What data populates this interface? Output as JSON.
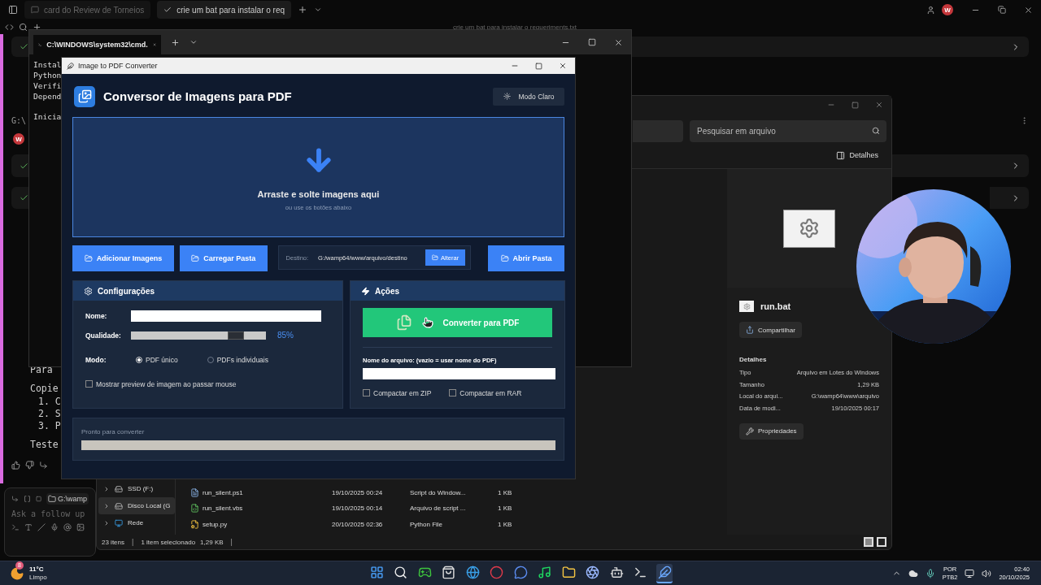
{
  "editor": {
    "tabs": [
      {
        "label": "card do Review de Torneios",
        "selected": false
      },
      {
        "label": "crie um bat para instalar o req",
        "selected": true
      }
    ],
    "avatar": "W",
    "thread_title": "crie um bat para instalar o requeriments.txt",
    "margin_text": "G:\\",
    "chat_avatar": "W",
    "chat_blocks": [
      {
        "kind": "text",
        "lines": [
          "Para"
        ]
      },
      {
        "kind": "text",
        "lines": [
          "Copie"
        ]
      },
      {
        "kind": "list",
        "lines": [
          "1. C",
          "2. S",
          "3. P"
        ]
      },
      {
        "kind": "text",
        "lines": [
          "Teste"
        ]
      }
    ],
    "composer": {
      "path": "G:\\wamp",
      "placeholder": "Ask a follow up"
    }
  },
  "cmd": {
    "tab": "C:\\WINDOWS\\system32\\cmd.",
    "blocks": [
      [
        "Instal",
        "Python",
        "Verifi",
        "Depend"
      ],
      [
        "Inicia"
      ]
    ]
  },
  "explorer": {
    "search": {
      "placeholder": "Pesquisar em arquivo"
    },
    "details_button": "Detalhes",
    "file": "run.bat",
    "share": "Compartilhar",
    "details_heading": "Detalhes",
    "properties": [
      {
        "label": "Tipo",
        "value": "Arquivo em Lotes do Windows"
      },
      {
        "label": "Tamanho",
        "value": "1,29 KB"
      },
      {
        "label": "Local do arqui...",
        "value": "G:\\wamp64\\www\\arquivo"
      },
      {
        "label": "Data de modi...",
        "value": "19/10/2025 00:17"
      }
    ],
    "properties_button": "Propriedades",
    "tree": [
      {
        "label": "SSD (F:)",
        "kind": "drive",
        "selected": false
      },
      {
        "label": "Disco Local (G",
        "kind": "drive",
        "selected": true
      },
      {
        "label": "Rede",
        "kind": "network",
        "selected": false
      }
    ],
    "files": [
      {
        "name": "run_silent.ps1",
        "kind": "script",
        "date": "19/10/2025 00:24",
        "type": "Script do Window...",
        "size": "1 KB"
      },
      {
        "name": "run_silent.vbs",
        "kind": "vbs",
        "date": "19/10/2025 00:14",
        "type": "Arquivo de script ...",
        "size": "1 KB"
      },
      {
        "name": "setup.py",
        "kind": "python",
        "date": "20/10/2025 02:36",
        "type": "Python File",
        "size": "1 KB"
      }
    ],
    "status": [
      {
        "kind": "text",
        "text": "23 itens"
      },
      {
        "kind": "separator",
        "text": "|"
      },
      {
        "kind": "text",
        "text": "1 item selecionado"
      },
      {
        "kind": "text",
        "text": "1,29 KB"
      },
      {
        "kind": "separator",
        "text": "|"
      }
    ]
  },
  "app": {
    "title": "Image to PDF Converter",
    "heading": "Conversor de Imagens para PDF",
    "theme_button": "Modo Claro",
    "dropzone": {
      "title": "Arraste e solte imagens aqui",
      "hint": "ou use os botões abaixo"
    },
    "buttons": [
      "Adicionar Imagens",
      "Carregar Pasta"
    ],
    "destination": {
      "label": "Destino:",
      "path": "G:/wamp64/www/arquivo/destino",
      "button": "Alterar"
    },
    "open_button": "Abrir Pasta",
    "settings": {
      "title": "Configurações",
      "name_label": "Nome:",
      "quality_label": "Qualidade:",
      "quality": {
        "level": 0.78,
        "reading": "85%"
      },
      "mode_label": "Modo:",
      "modes": [
        {
          "label": "PDF único",
          "selected": true
        },
        {
          "label": "PDFs individuais",
          "selected": false
        }
      ],
      "preview": {
        "label": "Mostrar preview de imagem ao passar mouse",
        "checked": false
      }
    },
    "actions": {
      "title": "Ações",
      "convert": "Converter para PDF",
      "filename_label": "Nome do arquivo: (vazio = usar nome do PDF)",
      "options": [
        {
          "label": "Compactar em ZIP",
          "checked": false
        },
        {
          "label": "Compactar em RAR",
          "checked": false
        }
      ]
    },
    "status": {
      "text": "Pronto para converter",
      "level": 0
    }
  },
  "taskbar": {
    "weather": {
      "badge": "8",
      "temp": "11°C",
      "condition": "Limpo"
    },
    "apps": [
      {
        "kind": "start",
        "selected": false
      },
      {
        "kind": "search",
        "selected": false
      },
      {
        "kind": "game",
        "selected": false
      },
      {
        "kind": "store",
        "selected": false
      },
      {
        "kind": "browser",
        "selected": false
      },
      {
        "kind": "ring",
        "selected": false
      },
      {
        "kind": "chat",
        "selected": false
      },
      {
        "kind": "music",
        "selected": false
      },
      {
        "kind": "folder",
        "selected": false
      },
      {
        "kind": "aperture",
        "selected": false
      },
      {
        "kind": "bot",
        "selected": false
      },
      {
        "kind": "terminal",
        "selected": false
      },
      {
        "kind": "feather",
        "selected": true
      }
    ],
    "lang": "POR",
    "layout": "PTB2",
    "time": "02:40",
    "date": "20/10/2025"
  }
}
